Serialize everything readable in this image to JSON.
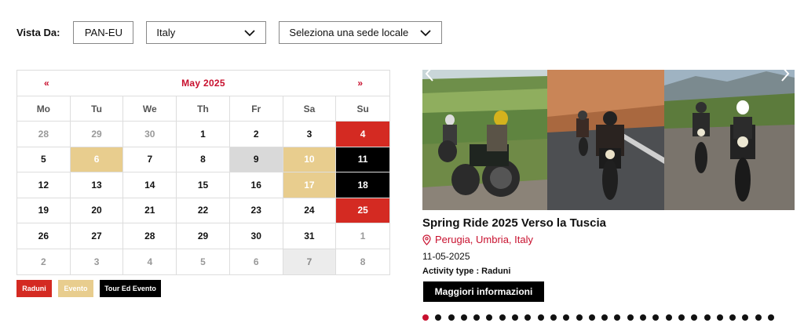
{
  "filters": {
    "label": "Vista Da:",
    "region": "PAN-EU",
    "country": "Italy",
    "local": "Seleziona una sede locale"
  },
  "calendar": {
    "prev": "«",
    "next": "»",
    "month": "May 2025",
    "weekdays": [
      "Mo",
      "Tu",
      "We",
      "Th",
      "Fr",
      "Sa",
      "Su"
    ],
    "days": [
      {
        "n": "28",
        "s": "other"
      },
      {
        "n": "29",
        "s": "other"
      },
      {
        "n": "30",
        "s": "other"
      },
      {
        "n": "1",
        "s": ""
      },
      {
        "n": "2",
        "s": ""
      },
      {
        "n": "3",
        "s": ""
      },
      {
        "n": "4",
        "s": "red"
      },
      {
        "n": "5",
        "s": ""
      },
      {
        "n": "6",
        "s": "tan"
      },
      {
        "n": "7",
        "s": ""
      },
      {
        "n": "8",
        "s": ""
      },
      {
        "n": "9",
        "s": "gray"
      },
      {
        "n": "10",
        "s": "tan"
      },
      {
        "n": "11",
        "s": "black"
      },
      {
        "n": "12",
        "s": ""
      },
      {
        "n": "13",
        "s": ""
      },
      {
        "n": "14",
        "s": ""
      },
      {
        "n": "15",
        "s": ""
      },
      {
        "n": "16",
        "s": ""
      },
      {
        "n": "17",
        "s": "tan"
      },
      {
        "n": "18",
        "s": "black"
      },
      {
        "n": "19",
        "s": ""
      },
      {
        "n": "20",
        "s": ""
      },
      {
        "n": "21",
        "s": ""
      },
      {
        "n": "22",
        "s": ""
      },
      {
        "n": "23",
        "s": ""
      },
      {
        "n": "24",
        "s": ""
      },
      {
        "n": "25",
        "s": "red"
      },
      {
        "n": "26",
        "s": ""
      },
      {
        "n": "27",
        "s": ""
      },
      {
        "n": "28",
        "s": ""
      },
      {
        "n": "29",
        "s": ""
      },
      {
        "n": "30",
        "s": ""
      },
      {
        "n": "31",
        "s": ""
      },
      {
        "n": "1",
        "s": "other"
      },
      {
        "n": "2",
        "s": "other"
      },
      {
        "n": "3",
        "s": "other"
      },
      {
        "n": "4",
        "s": "other"
      },
      {
        "n": "5",
        "s": "other"
      },
      {
        "n": "6",
        "s": "other"
      },
      {
        "n": "7",
        "s": "lightgray"
      },
      {
        "n": "8",
        "s": "other"
      }
    ]
  },
  "legend": {
    "raduni": "Raduni",
    "evento": "Evento",
    "tour": "Tour Ed Evento"
  },
  "carousel": {
    "prev_icon": "chevron-left-icon",
    "next_icon": "chevron-right-icon",
    "slide_count": 28,
    "active_slide": 0
  },
  "event": {
    "title": "Spring Ride 2025 Verso la Tuscia",
    "location": "Perugia, Umbria, Italy",
    "date": "11-05-2025",
    "activity": "Activity type : Raduni",
    "button": "Maggiori informazioni"
  },
  "colors": {
    "red": "#d42a22",
    "tan": "#e8cd8e",
    "black": "#000000",
    "brand_red": "#c8102e"
  }
}
